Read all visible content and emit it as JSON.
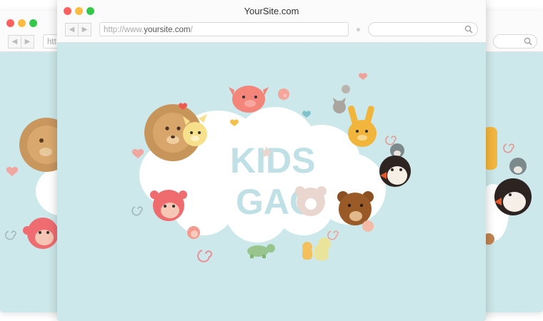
{
  "window": {
    "title": "YourSite.com"
  },
  "address_bar": {
    "prefix": "http://www.",
    "host": "yoursite.com",
    "suffix": "/",
    "short_text": "htt"
  },
  "search": {
    "placeholder": ""
  },
  "logo": {
    "line1": "KIDS",
    "line2": "GAO"
  },
  "colors": {
    "close": "#fc605c",
    "minimize": "#fdbc40",
    "zoom": "#34c84a",
    "content_bg": "#cde8ea",
    "logo_text": "#bfe0e5",
    "logo_accent": "#e9d7cf"
  },
  "icons": [
    "back-arrow-icon",
    "forward-arrow-icon",
    "search-icon",
    "lion-icon",
    "giraffe-icon",
    "pig-icon",
    "cat-icon",
    "rabbit-icon",
    "penguin-icon",
    "bear-icon",
    "monkey-icon",
    "turtle-icon",
    "spiral-icon",
    "heart-icon"
  ]
}
